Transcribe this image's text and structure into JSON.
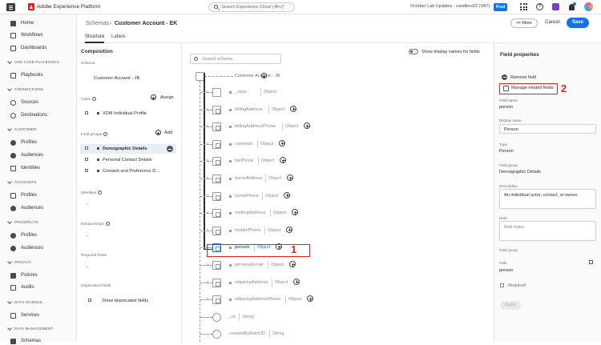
{
  "topbar": {
    "app_title": "Adobe Experience Platform",
    "search_placeholder": "Search Experience Cloud (⌘+/)",
    "org": "October Lab Updates - sandbox02 (VA7)",
    "env_badge": "Prod",
    "icons": [
      "menu-icon",
      "adobe-logo",
      "search-icon",
      "apps-grid-icon",
      "help-icon",
      "feedback-icon",
      "bell-icon",
      "avatar"
    ]
  },
  "sidebar": {
    "top_items": [
      {
        "label": "Home",
        "icon": "home-icon"
      },
      {
        "label": "Workflows",
        "icon": "workflows-icon"
      },
      {
        "label": "Dashboards",
        "icon": "dashboards-icon"
      }
    ],
    "sections": [
      {
        "title": "USE CASE PLAYBOOKS",
        "items": [
          {
            "label": "Playbooks",
            "icon": "playbooks-icon"
          }
        ]
      },
      {
        "title": "CONNECTIONS",
        "items": [
          {
            "label": "Sources",
            "icon": "sources-icon"
          },
          {
            "label": "Destinations",
            "icon": "destinations-icon"
          }
        ]
      },
      {
        "title": "CUSTOMER",
        "items": [
          {
            "label": "Profiles",
            "icon": "profiles-icon"
          },
          {
            "label": "Audiences",
            "icon": "audiences-icon"
          },
          {
            "label": "Identities",
            "icon": "identities-icon"
          }
        ]
      },
      {
        "title": "ACCOUNTS",
        "items": [
          {
            "label": "Profiles",
            "icon": "profiles-icon"
          },
          {
            "label": "Audiences",
            "icon": "audiences-icon"
          }
        ]
      },
      {
        "title": "PROSPECTS",
        "items": [
          {
            "label": "Profiles",
            "icon": "profiles-icon"
          },
          {
            "label": "Audiences",
            "icon": "audiences-icon"
          }
        ]
      },
      {
        "title": "PRIVACY",
        "items": [
          {
            "label": "Policies",
            "icon": "policies-icon"
          },
          {
            "label": "Audits",
            "icon": "audits-icon"
          }
        ]
      },
      {
        "title": "DATA SCIENCE",
        "items": [
          {
            "label": "Services",
            "icon": "services-icon"
          }
        ]
      },
      {
        "title": "DATA MANAGEMENT",
        "items": [
          {
            "label": "Schemas",
            "icon": "schemas-icon"
          }
        ]
      }
    ]
  },
  "header": {
    "breadcrumb_parent": "Schemas",
    "breadcrumb_sep": "›",
    "breadcrumb_current": "Customer Account - EK",
    "tabs": [
      {
        "label": "Structure"
      },
      {
        "label": "Labels"
      }
    ],
    "more_label": "More",
    "cancel_label": "Cancel",
    "save_label": "Save"
  },
  "composition": {
    "title": "Composition",
    "schema_label": "Schema",
    "schema_value": "Customer Account - JB",
    "class_label": "Class",
    "assign_label": "Assign",
    "class_value": "XDM Individual Profile",
    "field_groups_label": "Field groups",
    "add_label": "Add",
    "field_groups": [
      {
        "label": "Demographic Details",
        "selected": true
      },
      {
        "label": "Personal Contact Details",
        "selected": false
      },
      {
        "label": "Consent and Preference D...",
        "selected": false
      }
    ],
    "identities_label": "Identities",
    "identities_value": "-",
    "relationships_label": "Relationships",
    "relationships_value": "-",
    "required_label": "Required fields",
    "required_value": "-",
    "deprecated_label": "Deprecated fields",
    "show_deprecated_label": "Show deprecated fields"
  },
  "canvas": {
    "search_placeholder": "Search schema",
    "toggle_label": "Show display names for fields",
    "root_label": "Customer Account - JB",
    "nodes": [
      {
        "name": "_repo",
        "type": "Object",
        "plus": false
      },
      {
        "name": "billingAddress",
        "type": "Object",
        "plus": true
      },
      {
        "name": "billingAddressPhone",
        "type": "Object",
        "plus": true
      },
      {
        "name": "consents",
        "type": "Object",
        "plus": true
      },
      {
        "name": "faxPhone",
        "type": "Object",
        "plus": true
      },
      {
        "name": "homeAddress",
        "type": "Object",
        "plus": true
      },
      {
        "name": "homePhone",
        "type": "Object",
        "plus": true
      },
      {
        "name": "mailingAddress",
        "type": "Object",
        "plus": true
      },
      {
        "name": "mobilePhone",
        "type": "Object",
        "plus": true
      },
      {
        "name": "person",
        "type": "Object",
        "plus": true,
        "selected": true
      },
      {
        "name": "personalEmail",
        "type": "Object",
        "plus": true
      },
      {
        "name": "shippingAddress",
        "type": "Object",
        "plus": true
      },
      {
        "name": "shippingAddressPhone",
        "type": "Object",
        "plus": true
      },
      {
        "name": "_id",
        "type": "String",
        "plus": false
      },
      {
        "name": "createdByBatchID",
        "type": "String",
        "plus": false
      }
    ],
    "annotation_1": "1"
  },
  "props": {
    "title": "Field properties",
    "remove_label": "Remove field",
    "manage_label": "Manage related fields",
    "annotation_2": "2",
    "field_name_label": "Field name",
    "field_name_value": "person",
    "display_name_label": "Display name",
    "display_name_value": "Person",
    "type_label": "Type",
    "type_value": "Person",
    "field_group_label": "Field group",
    "field_group_value": "Demographic Details",
    "description_label": "Description",
    "description_value": "An individual actor, contact, or owner.",
    "note_label": "Note",
    "note_placeholder": "Add notes",
    "field_group2_label": "Field group",
    "path_label": "Path",
    "path_value": "person",
    "required_label": "Required",
    "apply_label": "Apply"
  }
}
